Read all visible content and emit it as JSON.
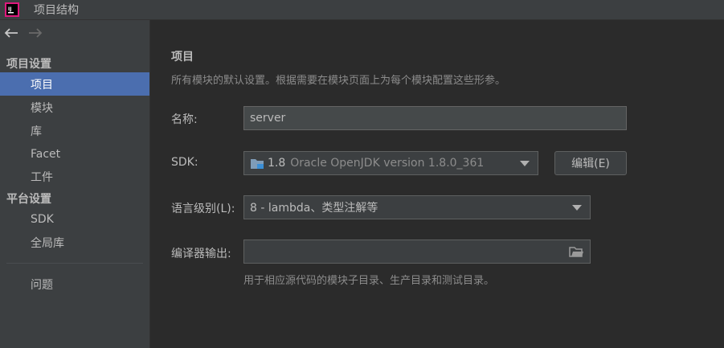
{
  "window": {
    "title": "项目结构"
  },
  "sidebar": {
    "section_project_settings": "项目设置",
    "items_project": [
      {
        "label": "项目",
        "selected": true
      },
      {
        "label": "模块"
      },
      {
        "label": "库"
      },
      {
        "label": "Facet"
      },
      {
        "label": "工件"
      }
    ],
    "section_platform_settings": "平台设置",
    "items_platform": [
      {
        "label": "SDK"
      },
      {
        "label": "全局库"
      }
    ],
    "problems": "问题"
  },
  "main": {
    "title": "项目",
    "description": "所有模块的默认设置。根据需要在模块页面上为每个模块配置这些形参。",
    "name_label": "名称:",
    "name_value": "server",
    "sdk_label": "SDK:",
    "sdk_value": "1.8",
    "sdk_version": "Oracle OpenJDK version 1.8.0_361",
    "edit_button": "编辑(E)",
    "language_level_label": "语言级别(L):",
    "language_level_value": "8 - lambda、类型注解等",
    "compiler_output_label": "编译器输出:",
    "compiler_output_value": "",
    "compiler_output_hint": "用于相应源代码的模块子目录、生产目录和测试目录。"
  },
  "colors": {
    "accent": "#4b6eaf",
    "background": "#2b2b2b",
    "panel": "#3c3f41"
  }
}
